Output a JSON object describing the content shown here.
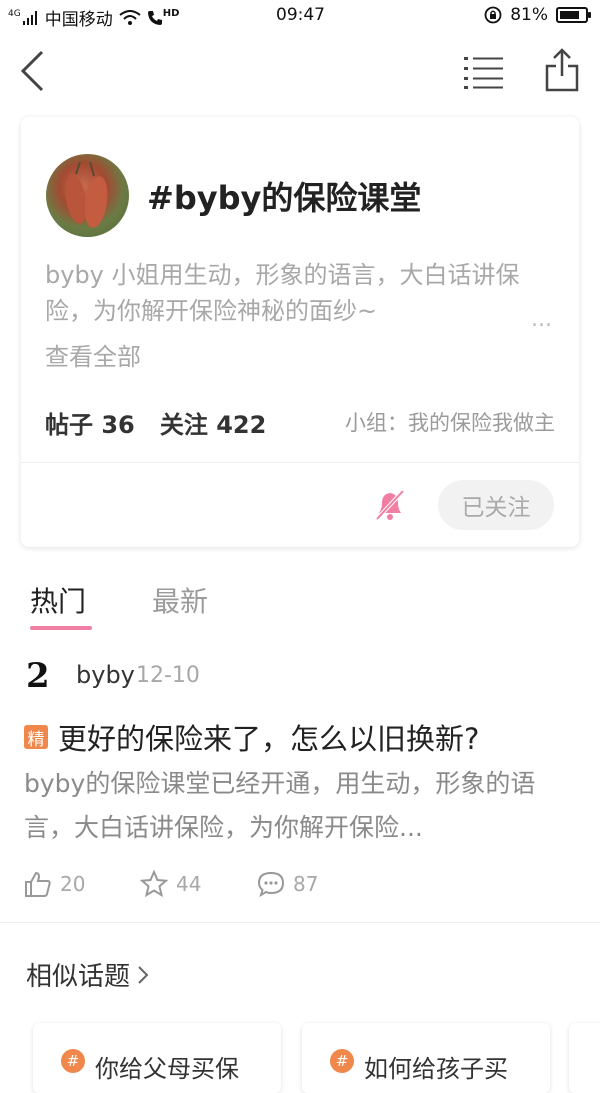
{
  "status_bar": {
    "network": "4G",
    "carrier": "中国移动",
    "hd_label": "HD",
    "time": "09:47",
    "battery_percent": "81%",
    "battery_level": 0.81
  },
  "topic": {
    "title": "#byby的保险课堂",
    "description": "byby 小姐用生动，形象的语言，大白话讲保险，为你解开保险神秘的面纱~",
    "more_glyph": "...",
    "see_all": "查看全部",
    "posts_label": "帖子",
    "posts_count": "36",
    "followers_label": "关注",
    "followers_count": "422",
    "group_label": "小组：我的保险我做主",
    "follow_button": "已关注"
  },
  "tabs": [
    {
      "label": "热门",
      "active": true
    },
    {
      "label": "最新",
      "active": false
    }
  ],
  "post": {
    "avatar_text": "2",
    "username": "byby",
    "date": "12-10",
    "badge": "精",
    "title": "更好的保险来了，怎么以旧换新?",
    "excerpt": "byby的保险课堂已经开通，用生动，形象的语言，大白话讲保险，为你解开保险...",
    "likes": "20",
    "stars": "44",
    "comments": "87"
  },
  "similar": {
    "title": "相似话题",
    "items": [
      {
        "text": "你给父母买保"
      },
      {
        "text": "如何给孩子买"
      }
    ]
  },
  "colors": {
    "accent_pink": "#f07fa3",
    "badge_orange": "#f0874b"
  }
}
